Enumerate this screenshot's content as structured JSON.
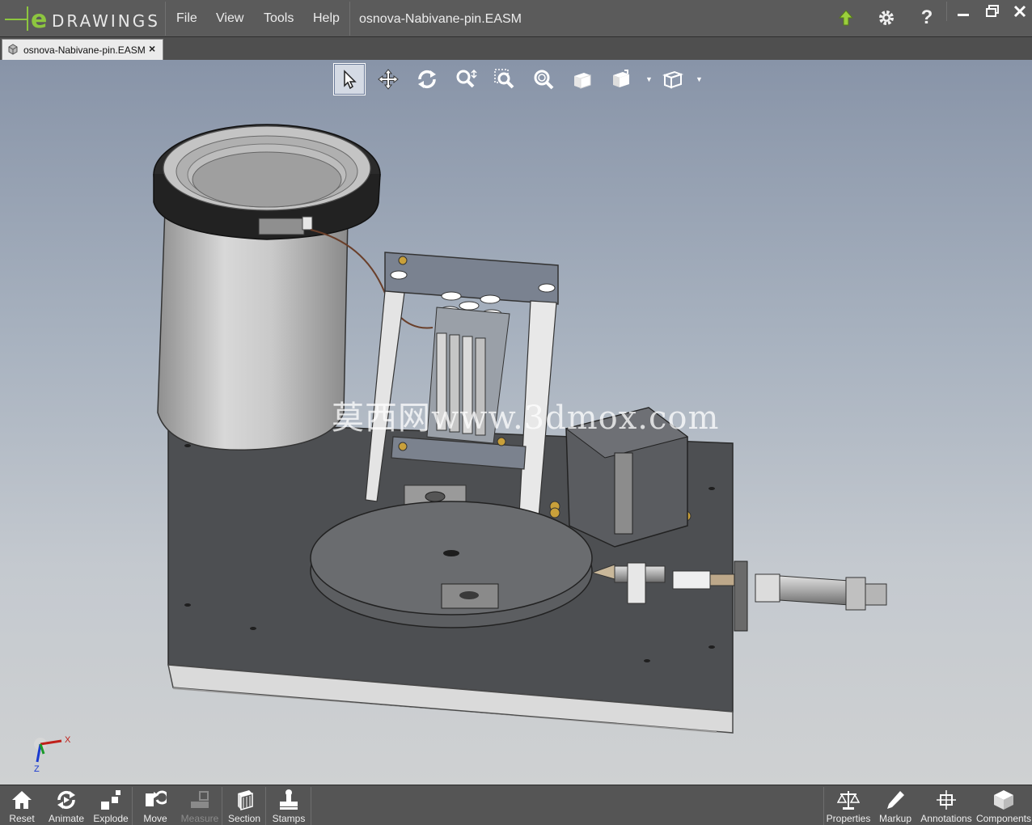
{
  "app": {
    "logo_text": "DRAWINGS",
    "logo_mark": "e",
    "document_title": "osnova-Nabivane-pin.EASM"
  },
  "menu": {
    "items": [
      {
        "label": "File"
      },
      {
        "label": "View"
      },
      {
        "label": "Tools"
      },
      {
        "label": "Help"
      }
    ]
  },
  "title_icons": [
    "upload-arrow-icon",
    "gear-icon",
    "help-icon"
  ],
  "window_controls": [
    "minimize-icon",
    "restore-icon",
    "close-icon"
  ],
  "tabs": [
    {
      "label": "osnova-Nabivane-pin.EASM",
      "close": "×",
      "active": true
    }
  ],
  "view_toolbar": [
    {
      "name": "select-tool",
      "icon": "cursor-arrow-icon",
      "active": true
    },
    {
      "name": "pan-tool",
      "icon": "move-arrows-icon"
    },
    {
      "name": "rotate-tool",
      "icon": "rotate-icon"
    },
    {
      "name": "zoom-tool",
      "icon": "zoom-dynamic-icon"
    },
    {
      "name": "zoom-to-area-tool",
      "icon": "zoom-area-icon"
    },
    {
      "name": "zoom-to-fit-tool",
      "icon": "zoom-fit-icon"
    },
    {
      "name": "shaded-view-tool",
      "icon": "shaded-cube-icon"
    },
    {
      "name": "standard-views-tool",
      "icon": "standard-views-icon",
      "dropdown": true
    },
    {
      "name": "display-style-tool",
      "icon": "display-style-icon",
      "dropdown": true
    }
  ],
  "watermark": "莫西网www.3dmox.com",
  "triad": {
    "x_label": "X",
    "z_label": "Z"
  },
  "bottom_left": [
    {
      "label": "Reset",
      "icon": "home-icon",
      "enabled": true
    },
    {
      "label": "Animate",
      "icon": "animate-icon",
      "enabled": true
    },
    {
      "label": "Explode",
      "icon": "explode-icon",
      "enabled": true
    },
    {
      "label": "Move",
      "icon": "move-icon",
      "enabled": true
    },
    {
      "label": "Measure",
      "icon": "measure-icon",
      "enabled": false
    },
    {
      "label": "Section",
      "icon": "section-icon",
      "enabled": true
    },
    {
      "label": "Stamps",
      "icon": "stamps-icon",
      "enabled": true
    }
  ],
  "bottom_right": [
    {
      "label": "Properties",
      "icon": "scales-icon"
    },
    {
      "label": "Markup",
      "icon": "pencil-icon"
    },
    {
      "label": "Annotations",
      "icon": "annotations-icon"
    },
    {
      "label": "Components",
      "icon": "components-icon"
    }
  ],
  "colors": {
    "titlebar": "#5b5b5b",
    "logo_green": "#8dc63f",
    "viewport_top": "#8894a8",
    "viewport_bottom": "#cfd1d2",
    "bottombar": "#555555"
  }
}
